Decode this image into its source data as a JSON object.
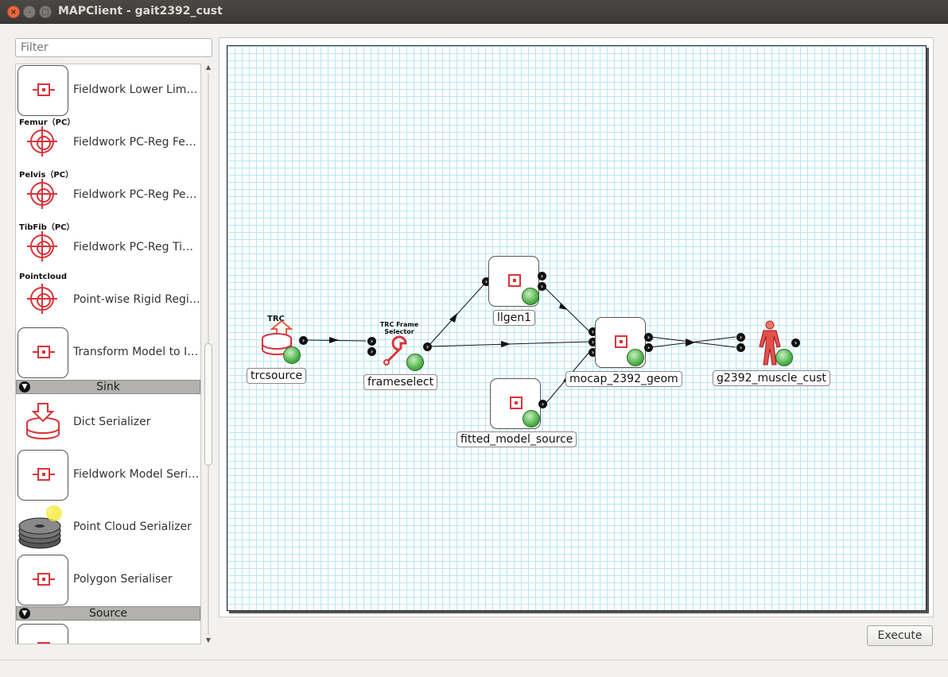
{
  "window": {
    "title": "MAPClient - gait2392_cust",
    "close_glyph": "×",
    "min_glyph": "–",
    "max_glyph": "□"
  },
  "filter": {
    "placeholder": "Filter"
  },
  "plugins": [
    {
      "label": "Fieldwork Lower Lim…",
      "caption": "",
      "icon": "box-icon"
    },
    {
      "label": "Fieldwork PC-Reg Fe…",
      "caption": "Femur（PC）",
      "icon": "target-icon"
    },
    {
      "label": "Fieldwork PC-Reg Pe…",
      "caption": "Pelvis（PC）",
      "icon": "target-icon"
    },
    {
      "label": "Fieldwork PC-Reg Ti…",
      "caption": "TibFib（PC）",
      "icon": "target-icon"
    },
    {
      "label": "Point-wise Rigid Regi…",
      "caption": "Pointcloud",
      "icon": "target-icon"
    },
    {
      "label": "Transform Model to I…",
      "caption": "",
      "icon": "box-icon"
    }
  ],
  "sections": {
    "sink": "Sink",
    "source": "Source"
  },
  "sink_plugins": [
    {
      "label": "Dict Serializer",
      "icon": "database-download-icon"
    },
    {
      "label": "Fieldwork Model Seri…",
      "icon": "box-icon"
    },
    {
      "label": "Point Cloud Serializer",
      "icon": "disk-stack-icon"
    },
    {
      "label": "Polygon Serialiser",
      "icon": "box-icon"
    }
  ],
  "workflow": {
    "nodes": {
      "trcsource": {
        "label": "trcsource",
        "caption": "TRC"
      },
      "frameselect": {
        "label": "frameselect",
        "caption": "TRC Frame Selector"
      },
      "llgen1": {
        "label": "llgen1"
      },
      "mocap": {
        "label": "mocap_2392_geom"
      },
      "fitted": {
        "label": "fitted_model_source"
      },
      "g2392": {
        "label": "g2392_muscle_cust"
      }
    }
  },
  "buttons": {
    "execute": "Execute"
  },
  "colors": {
    "accent_red": "#d9343a",
    "grid": "#b7e6f5",
    "status_green": "#4fb24a"
  }
}
